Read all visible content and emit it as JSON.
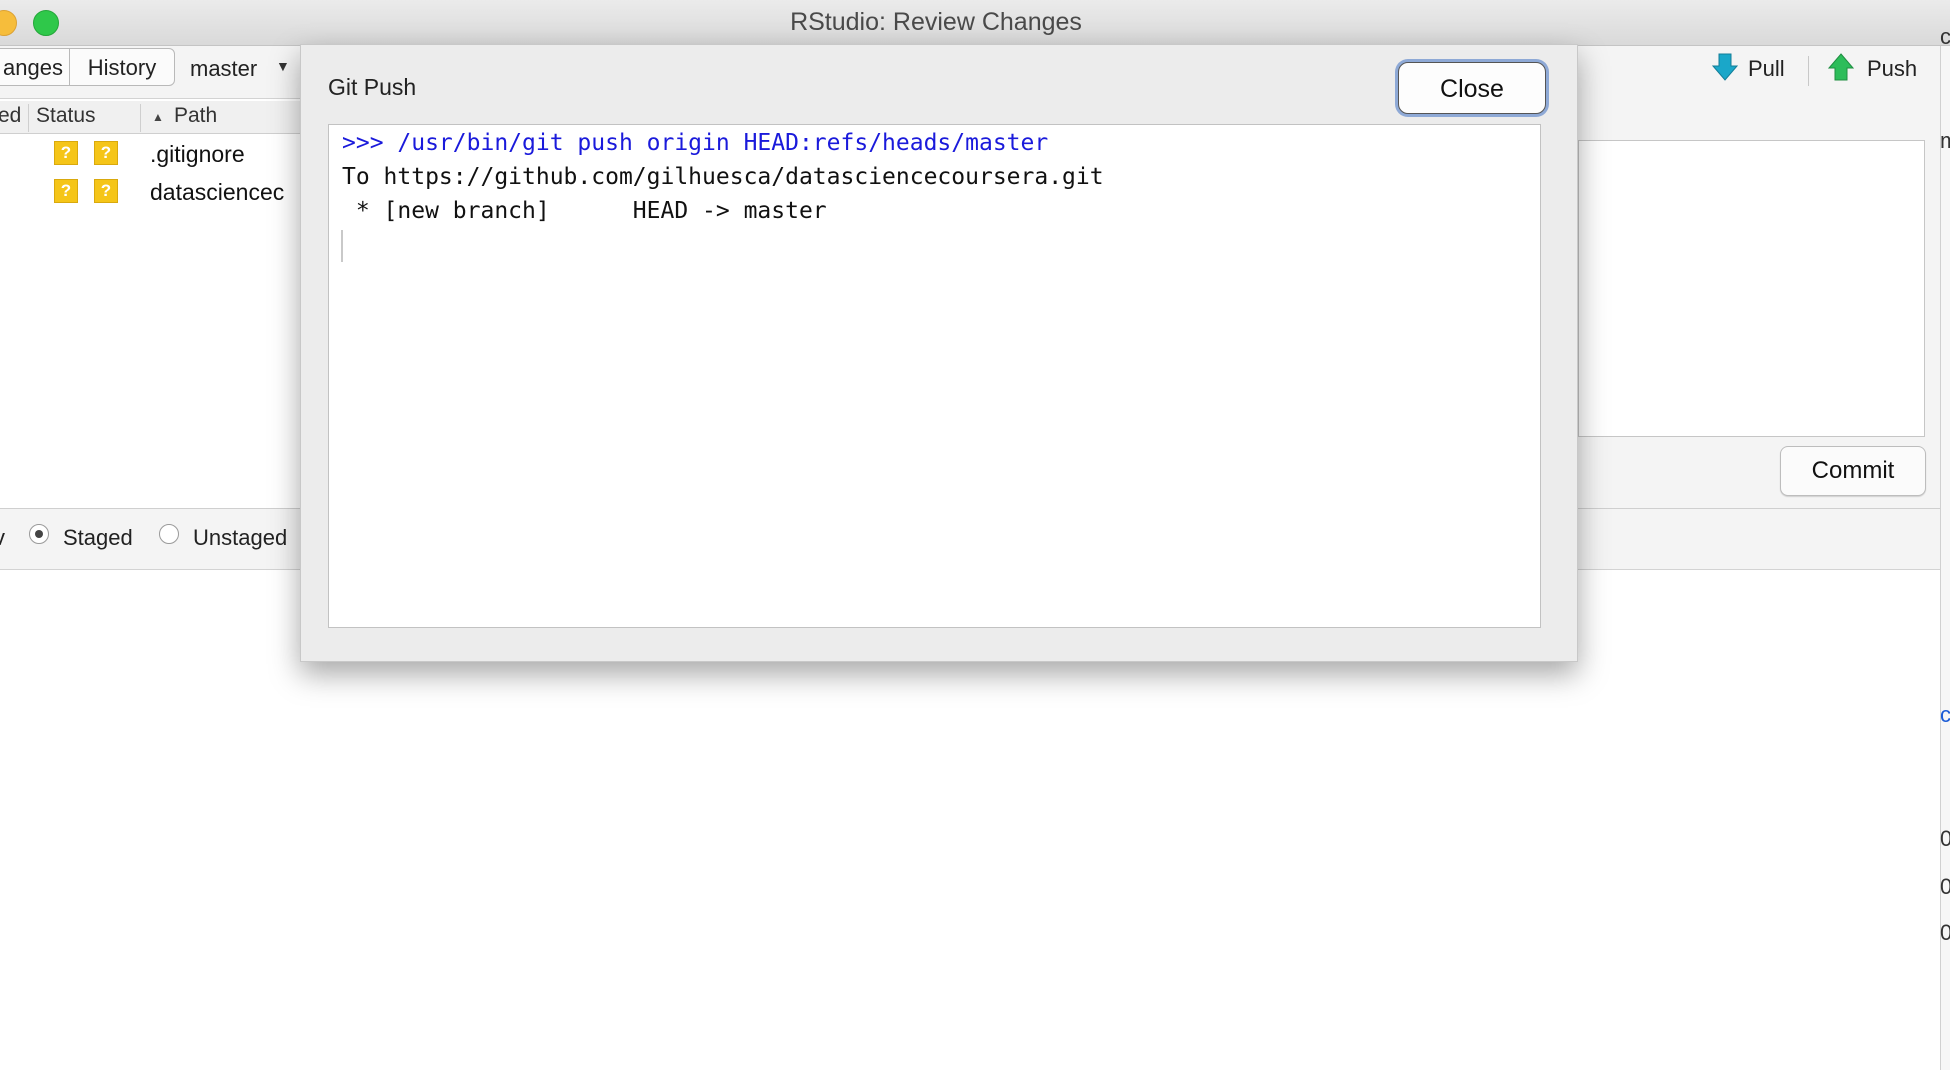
{
  "window": {
    "title": "RStudio: Review Changes"
  },
  "toolbar": {
    "tabs": [
      {
        "label": "anges",
        "selected": true
      },
      {
        "label": "History",
        "selected": false
      }
    ],
    "branch": "master",
    "pull_label": "Pull",
    "push_label": "Push",
    "pull_icon": "arrow-down-icon",
    "push_icon": "arrow-up-icon"
  },
  "file_table": {
    "columns": [
      "ed",
      "Status",
      "Path"
    ],
    "sort_column": "Path",
    "rows": [
      {
        "status": [
          "?",
          "?"
        ],
        "path": ".gitignore"
      },
      {
        "status": [
          "?",
          "?"
        ],
        "path": "datasciencec"
      }
    ]
  },
  "diff_view": {
    "left_fragment": "v",
    "options": [
      {
        "label": "Staged",
        "selected": true
      },
      {
        "label": "Unstaged",
        "selected": false
      }
    ]
  },
  "commit": {
    "button_label": "Commit"
  },
  "right_edge_glyphs": {
    "top": "c",
    "second": "m",
    "link": "c",
    "nums": [
      "0",
      "0",
      "0"
    ]
  },
  "dialog": {
    "title": "Git Push",
    "close_label": "Close",
    "console_lines": [
      ">>> /usr/bin/git push origin HEAD:refs/heads/master",
      "To https://github.com/gilhuesca/datasciencecoursera.git",
      " * [new branch]      HEAD -> master"
    ]
  },
  "colors": {
    "command_text": "#1a1adb",
    "status_badge": "#f5c518",
    "pull_arrow": "#1aa7c9",
    "push_arrow": "#2dbd5a",
    "close_focus_ring": "#8ea9d6"
  }
}
